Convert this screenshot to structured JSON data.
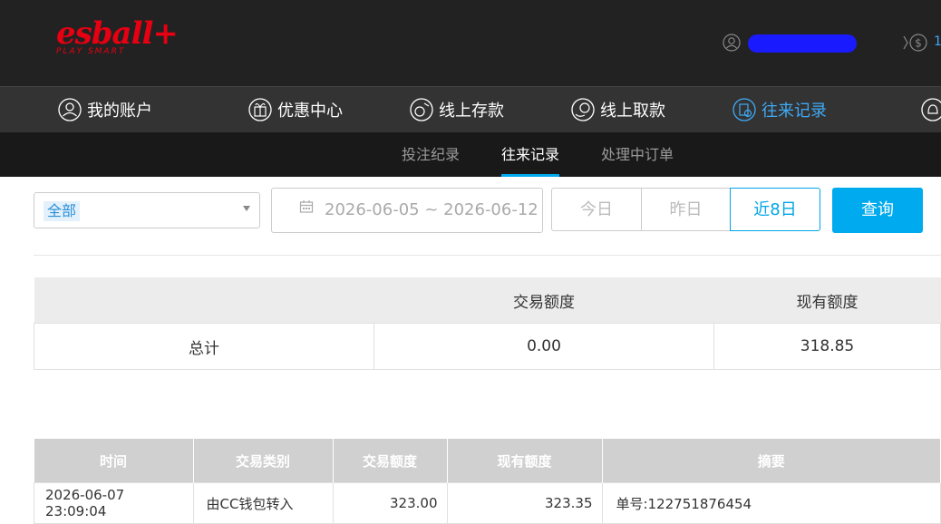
{
  "brand": {
    "logo_text": "esball+",
    "tagline": "PLAY SMART"
  },
  "header": {
    "coin_value": "1"
  },
  "main_nav": [
    {
      "label": "我的账户",
      "icon": "user-icon"
    },
    {
      "label": "优惠中心",
      "icon": "gift-icon"
    },
    {
      "label": "线上存款",
      "icon": "deposit-icon"
    },
    {
      "label": "线上取款",
      "icon": "withdraw-icon"
    },
    {
      "label": "往来记录",
      "icon": "records-icon"
    },
    {
      "label": "",
      "icon": "bell-icon"
    }
  ],
  "sub_nav": [
    {
      "label": "投注纪录"
    },
    {
      "label": "往来记录"
    },
    {
      "label": "处理中订单"
    }
  ],
  "filter": {
    "selected": "全部",
    "date_range": "2026-06-05 ~ 2026-06-12",
    "quick": [
      "今日",
      "昨日",
      "近8日"
    ],
    "active_quick": "近8日",
    "query_label": "查询"
  },
  "summary": {
    "headers": [
      "",
      "交易额度",
      "现有额度"
    ],
    "row": [
      "总计",
      "0.00",
      "318.85"
    ]
  },
  "records": {
    "headers": [
      "时间",
      "交易类别",
      "交易额度",
      "现有额度",
      "摘要"
    ],
    "rows": [
      [
        "2026-06-07 23:09:04",
        "由CC钱包转入",
        "323.00",
        "323.35",
        "单号:122751876454"
      ]
    ]
  },
  "colors": {
    "accent": "#00aaee",
    "brand": "#e60012"
  }
}
